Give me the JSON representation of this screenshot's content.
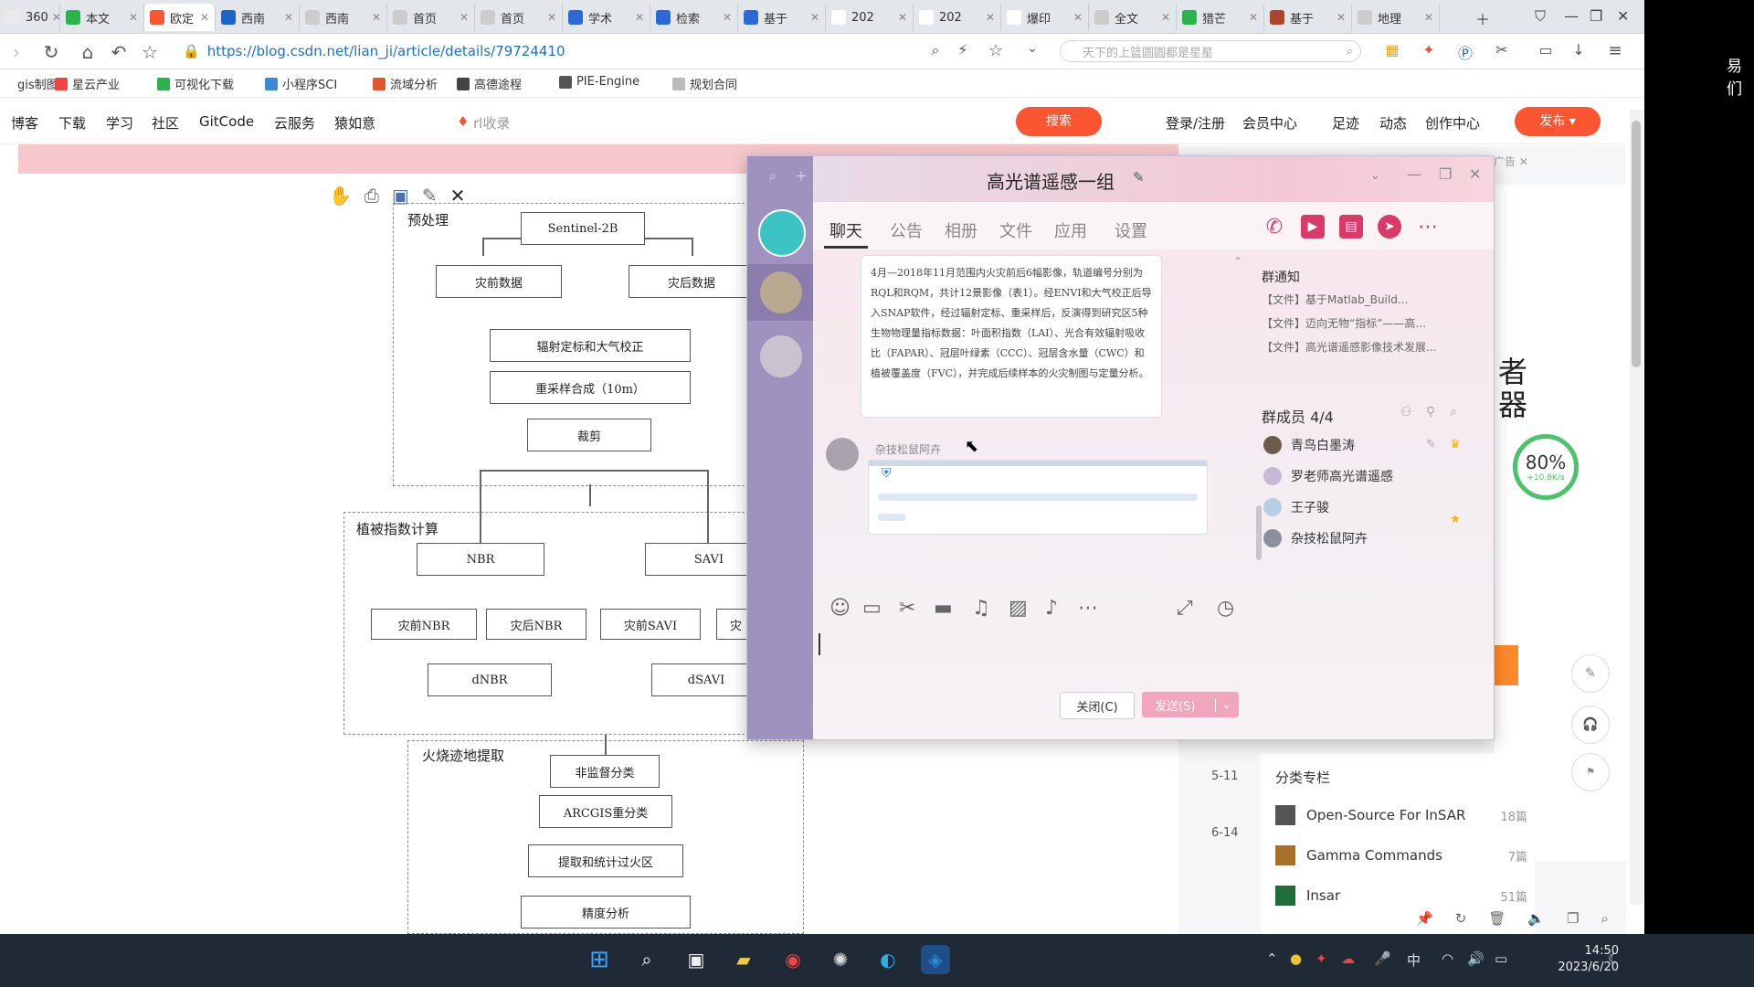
{
  "browser": {
    "tabs": [
      {
        "label": "360",
        "color": "#e9e9e9"
      },
      {
        "label": "本文",
        "color": "#2bb24c"
      },
      {
        "label": "欧定",
        "color": "#fc5531"
      },
      {
        "label": "西南",
        "color": "#1e64c8"
      },
      {
        "label": "西南",
        "color": "#cccccc"
      },
      {
        "label": "首页",
        "color": "#cccccc"
      },
      {
        "label": "首页",
        "color": "#cccccc"
      },
      {
        "label": "学术",
        "color": "#2a6ad8"
      },
      {
        "label": "检索",
        "color": "#2a6ad8"
      },
      {
        "label": "基于",
        "color": "#2a6ad8"
      },
      {
        "label": "202",
        "color": "#ffffff"
      },
      {
        "label": "202",
        "color": "#ffffff"
      },
      {
        "label": "爆印",
        "color": "#ffffff"
      },
      {
        "label": "全文",
        "color": "#cccccc"
      },
      {
        "label": "猎芒",
        "color": "#2bb24c"
      },
      {
        "label": "基于",
        "color": "#b0432c"
      },
      {
        "label": "地理",
        "color": "#cccccc"
      }
    ],
    "url": "https://blog.csdn.net/lian_ji/article/details/79724410",
    "search_placeholder": "天下的上篮圆圆都是星星",
    "bookmarks": [
      "gis制图",
      "星云产业",
      "可视化下载",
      "小程序SCI",
      "流域分析",
      "高德途程",
      "PIE-Engine",
      "规划合同"
    ]
  },
  "site": {
    "nav": [
      "博客",
      "下载",
      "学习",
      "社区",
      "GitCode",
      "云服务",
      "猿如意"
    ],
    "search_hint": "rl收录",
    "search_button": "搜索",
    "user_nav": [
      "登录/注册",
      "会员中心",
      "足迹",
      "动态",
      "创作中心"
    ],
    "publish_button": "发布"
  },
  "flowchart": {
    "toolbar_close": "✕",
    "sections": {
      "pre": "预处理",
      "index": "植被指数计算",
      "fire": "火烧迹地提取"
    },
    "boxes": {
      "sentinel": "Sentinel-2B",
      "pre_a": "灾前数据",
      "pre_b": "灾后数据",
      "atm": "辐射定标和大气校正",
      "resample": "重采样合成（10m）",
      "clip": "裁剪",
      "nbr": "NBR",
      "savi": "SAVI",
      "nbr_pre": "灾前NBR",
      "nbr_post": "灾后NBR",
      "savi_pre": "灾前SAVI",
      "savi_post": "灾",
      "dnbr": "dNBR",
      "dsavi": "dSAVI",
      "cls": "非监督分类",
      "arcgis": "ARCGIS重分类",
      "extract": "提取和统计过火区",
      "accuracy": "精度分析"
    }
  },
  "chat": {
    "title": "高光谱遥感一组",
    "tabs": [
      "聊天",
      "公告",
      "相册",
      "文件",
      "应用",
      "设置"
    ],
    "message_text": "4月—2018年11月范围内火灾前后6幅影像，轨道编号分别为RQL和RQM，共计12景影像（表1）。经ENVI和大气校正后导入SNAP软件，经过辐射定标、重采样后，反演得到研究区5种生物物理量指标数据：叶面积指数（LAI）、光合有效辐射吸收比（FAPAR）、冠层叶绿素（CCC）、冠层含水量（CWC）和植被覆盖度（FVC），并完成后续样本的火灾制图与定量分析。",
    "sender_name": "杂技松鼠阿卉",
    "notice_title": "群通知",
    "notices": [
      "【文件】基于Matlab_Build...",
      "【文件】迈向无物“指标”——高...",
      "【文件】高光谱遥感影像技术发展..."
    ],
    "members_title": "群成员 4/4",
    "members": [
      "青鸟白墨涛",
      "罗老师高光谱遥感",
      "王子骏",
      "杂技松鼠阿卉"
    ],
    "close_label": "关闭(C)",
    "send_label": "发送(S)"
  },
  "right_panel": {
    "ad_label": "广告",
    "dates": [
      "5-11",
      "6-14"
    ],
    "category_title": "分类专栏",
    "categories": [
      {
        "name": "Open-Source For InSAR",
        "count": "18篇"
      },
      {
        "name": "Gamma Commands",
        "count": "7篇"
      },
      {
        "name": "Insar",
        "count": "51篇"
      }
    ],
    "speed_value": "80%",
    "speed_rate": "+10.8K/s",
    "big_chars": [
      "者",
      "器"
    ],
    "edge_char": "易们"
  },
  "taskbar": {
    "time": "14:50",
    "date": "2023/6/20",
    "ime": "中"
  }
}
